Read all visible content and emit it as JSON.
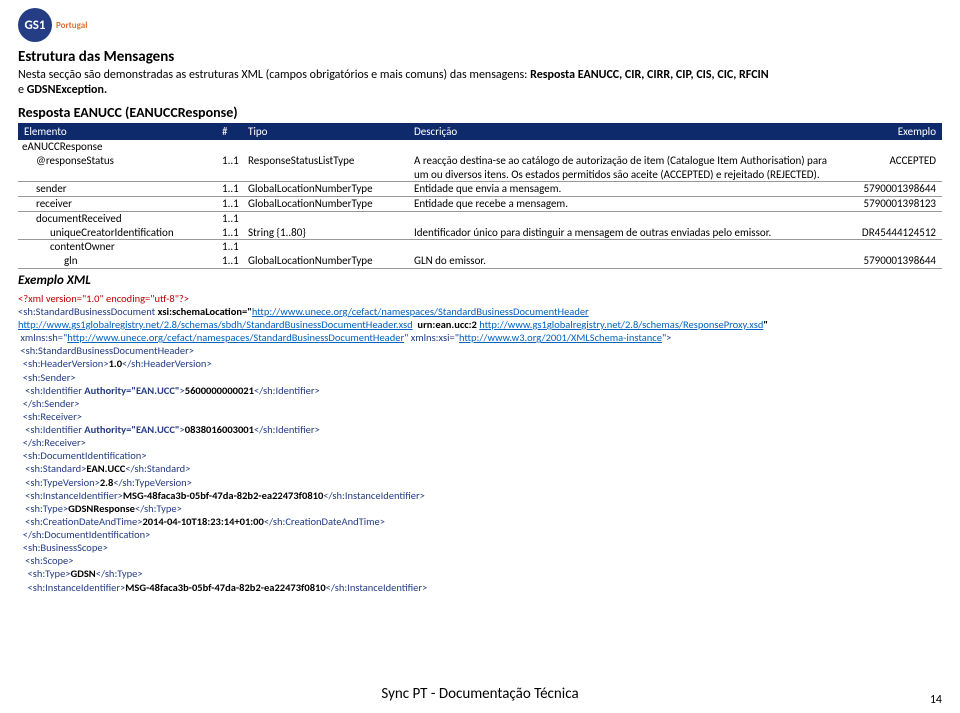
{
  "logo": {
    "text": "GS1",
    "sub": "Portugal"
  },
  "h1": "Estrutura das Mensagens",
  "intro_a": "Nesta secção são demonstradas as estruturas XML (campos obrigatórios e mais comuns) das mensagens: ",
  "intro_b": "Resposta EANUCC, CIR, CIRR, CIP, CIS, CIC, RFCIN",
  "intro_c": "e ",
  "intro_d": "GDSNException.",
  "h2": "Resposta EANUCC (EANUCCResponse)",
  "table_header": {
    "elemento": "Elemento",
    "hash": "#",
    "tipo": "Tipo",
    "descricao": "Descrição",
    "exemplo": "Exemplo"
  },
  "rows": [
    {
      "indent": 0,
      "el": "eANUCCResponse",
      "hash": "",
      "tipo": "",
      "desc": "",
      "ex": "",
      "border": false
    },
    {
      "indent": 1,
      "el": "@responseStatus",
      "hash": "1..1",
      "tipo": "ResponseStatusListType",
      "desc": "A reacção destina-se ao catálogo de autorização de item (Catalogue Item Authorisation) para um ou diversos itens. Os estados permitidos são aceite (ACCEPTED) e rejeitado (REJECTED).",
      "ex": "ACCEPTED",
      "border": true
    },
    {
      "indent": 1,
      "el": "sender",
      "hash": "1..1",
      "tipo": "GlobalLocationNumberType",
      "desc": "Entidade que envia a mensagem.",
      "ex": "5790001398644",
      "border": true
    },
    {
      "indent": 1,
      "el": "receiver",
      "hash": "1..1",
      "tipo": "GlobalLocationNumberType",
      "desc": "Entidade que recebe a mensagem.",
      "ex": "5790001398123",
      "border": true
    },
    {
      "indent": 1,
      "el": "documentReceived",
      "hash": "1..1",
      "tipo": "",
      "desc": "",
      "ex": "",
      "border": false
    },
    {
      "indent": 2,
      "el": "uniqueCreatorIdentification",
      "hash": "1..1",
      "tipo": "String {1..80}",
      "desc": "Identificador único para distinguir a mensagem de outras enviadas pelo emissor.",
      "ex": "DR45444124512",
      "border": true
    },
    {
      "indent": 2,
      "el": "contentOwner",
      "hash": "1..1",
      "tipo": "",
      "desc": "",
      "ex": "",
      "border": false
    },
    {
      "indent": 3,
      "el": "gln",
      "hash": "1..1",
      "tipo": "GlobalLocationNumberType",
      "desc": "GLN do emissor.",
      "ex": "5790001398644",
      "border": true
    }
  ],
  "exemplo_title": "Exemplo XML",
  "xml": {
    "decl": "<?xml version=\"1.0\" encoding=\"utf-8\"?>",
    "l1a": "<sh:StandardBusinessDocument ",
    "l1b": "xsi:schemaLocation=\"",
    "l1c": "http://www.unece.org/cefact/namespaces/StandardBusinessDocumentHeader",
    "l2a": "http://www.gs1globalregistry.net/2.8/schemas/sbdh/StandardBusinessDocumentHeader.xsd",
    "l2b": "  urn:ean.ucc:2 ",
    "l2c": "http://www.gs1globalregistry.net/2.8/schemas/ResponseProxy.xsd",
    "l2d": "\"",
    "l3a": " xmlns:sh=\"",
    "l3b": "http://www.unece.org/cefact/namespaces/StandardBusinessDocumentHeader",
    "l3c": "\" xmlns:xsi=\"",
    "l3d": "http://www.w3.org/2001/XMLSchema-instance",
    "l3e": "\">",
    "l4": " <sh:StandardBusinessDocumentHeader>",
    "l5a": "  <sh:HeaderVersion>",
    "l5b": "1.0",
    "l5c": "</sh:HeaderVersion>",
    "l6": "  <sh:Sender>",
    "l7a": "   <sh:Identifier ",
    "l7b": "Authority=\"EAN.UCC\"",
    "l7c": ">",
    "l7d": "5600000000021",
    "l7e": "</sh:Identifier>",
    "l8": "  </sh:Sender>",
    "l9": "  <sh:Receiver>",
    "l10a": "   <sh:Identifier ",
    "l10b": "Authority=\"EAN.UCC\"",
    "l10c": ">",
    "l10d": "0838016003001",
    "l10e": "</sh:Identifier>",
    "l11": "  </sh:Receiver>",
    "l12": "  <sh:DocumentIdentification>",
    "l13a": "   <sh:Standard>",
    "l13b": "EAN.UCC",
    "l13c": "</sh:Standard>",
    "l14a": "   <sh:TypeVersion>",
    "l14b": "2.8",
    "l14c": "</sh:TypeVersion>",
    "l15a": "   <sh:InstanceIdentifier>",
    "l15b": "MSG-48faca3b-05bf-47da-82b2-ea22473f0810",
    "l15c": "</sh:InstanceIdentifier>",
    "l16a": "   <sh:Type>",
    "l16b": "GDSNResponse",
    "l16c": "</sh:Type>",
    "l17a": "   <sh:CreationDateAndTime>",
    "l17b": "2014-04-10T18:23:14+01:00",
    "l17c": "</sh:CreationDateAndTime>",
    "l18": "  </sh:DocumentIdentification>",
    "l19": "  <sh:BusinessScope>",
    "l20": "   <sh:Scope>",
    "l21a": "    <sh:Type>",
    "l21b": "GDSN",
    "l21c": "</sh:Type>",
    "l22a": "    <sh:InstanceIdentifier>",
    "l22b": "MSG-48faca3b-05bf-47da-82b2-ea22473f0810",
    "l22c": "</sh:InstanceIdentifier>"
  },
  "footer": "Sync PT - Documentação Técnica",
  "page": "14"
}
